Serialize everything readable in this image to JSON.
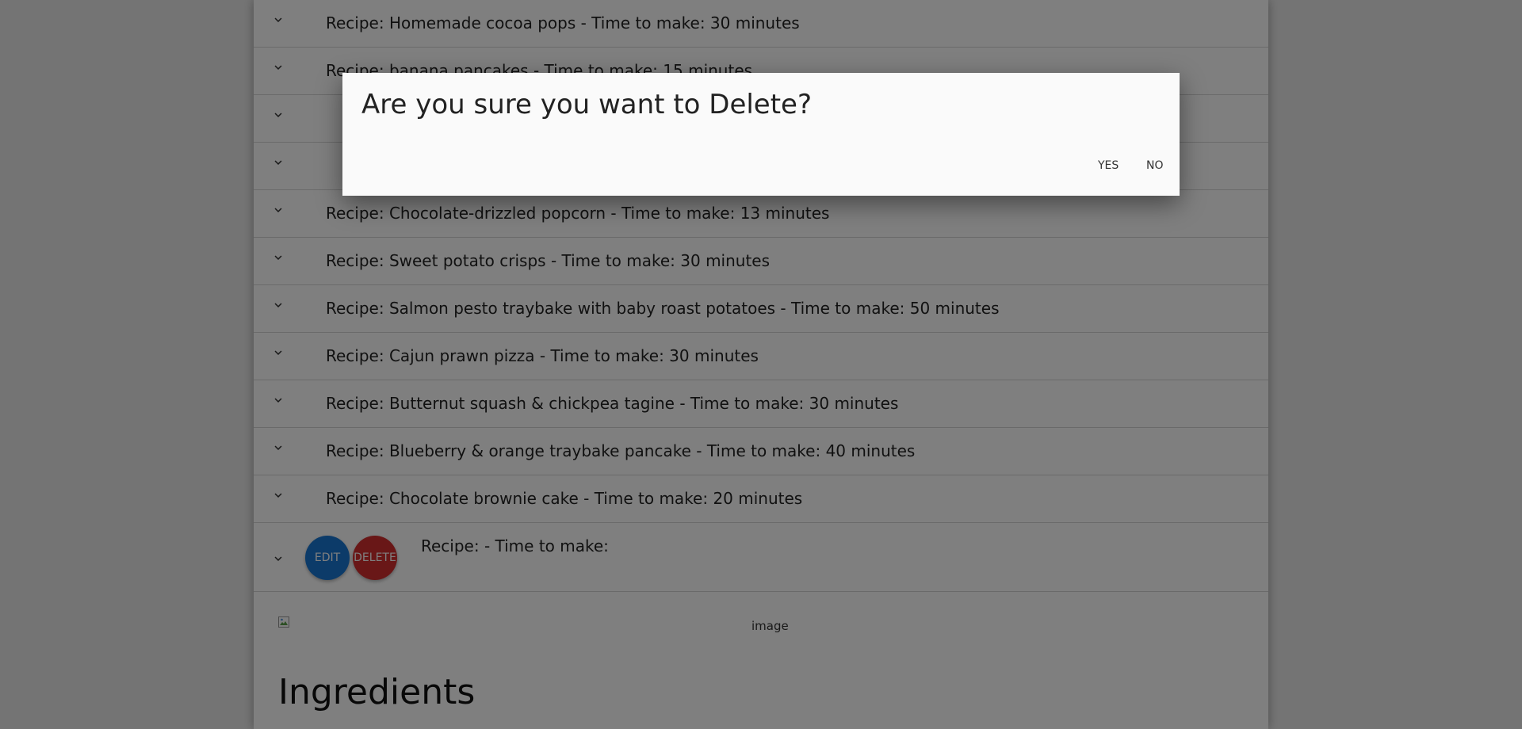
{
  "recipes": [
    {
      "label": "Recipe: Homemade cocoa pops - Time to make: 30 minutes"
    },
    {
      "label": "Recipe: banana pancakes - Time to make: 15 minutes"
    },
    {
      "label": ""
    },
    {
      "label": ""
    },
    {
      "label": "Recipe: Chocolate-drizzled popcorn - Time to make: 13 minutes"
    },
    {
      "label": "Recipe: Sweet potato crisps - Time to make: 30 minutes"
    },
    {
      "label": "Recipe: Salmon pesto traybake with baby roast potatoes - Time to make: 50 minutes"
    },
    {
      "label": "Recipe: Cajun prawn pizza - Time to make: 30 minutes"
    },
    {
      "label": "Recipe: Butternut squash & chickpea tagine - Time to make: 30 minutes"
    },
    {
      "label": "Recipe: Blueberry & orange traybake pancake - Time to make: 40 minutes"
    },
    {
      "label": "Recipe: Chocolate brownie cake - Time to make: 20 minutes"
    }
  ],
  "expanded_recipe": {
    "label": "Recipe: - Time to make:",
    "edit_label": "EDIT",
    "delete_label": "DELETE",
    "image_alt": "image",
    "ingredients_heading": "Ingredients"
  },
  "dialog": {
    "title": "Are you sure you want to Delete?",
    "yes_label": "YES",
    "no_label": "NO"
  },
  "colors": {
    "edit_button": "#1976d2",
    "delete_button": "#d32f2f",
    "overlay": "rgba(0,0,0,0.5)"
  }
}
